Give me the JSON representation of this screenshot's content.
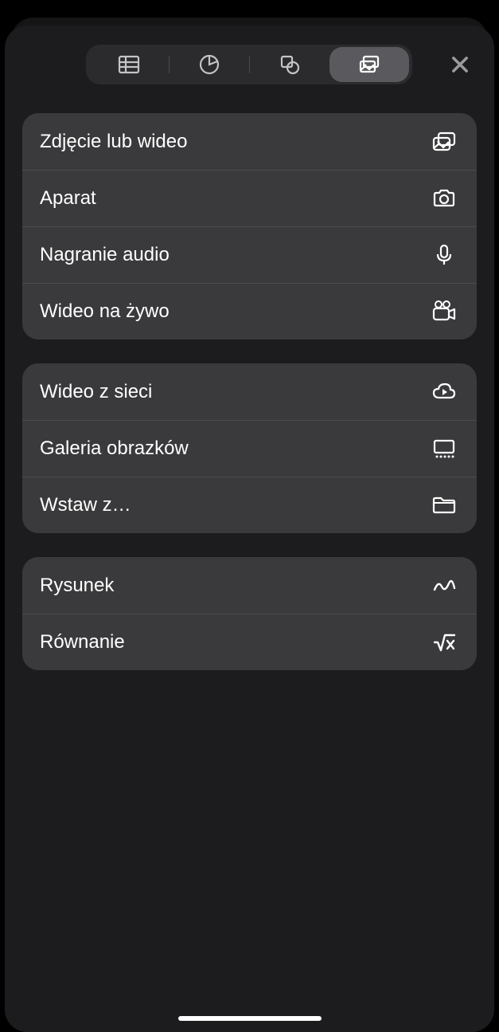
{
  "segments": {
    "tables": "tables",
    "charts": "charts",
    "shapes": "shapes",
    "media": "media"
  },
  "groups": [
    {
      "items": [
        {
          "label": "Zdjęcie lub wideo",
          "icon": "photo-video-icon"
        },
        {
          "label": "Aparat",
          "icon": "camera-icon"
        },
        {
          "label": "Nagranie audio",
          "icon": "microphone-icon"
        },
        {
          "label": "Wideo na żywo",
          "icon": "video-camera-icon"
        }
      ]
    },
    {
      "items": [
        {
          "label": "Wideo z sieci",
          "icon": "cloud-play-icon"
        },
        {
          "label": "Galeria obrazków",
          "icon": "gallery-icon"
        },
        {
          "label": "Wstaw z…",
          "icon": "folder-icon"
        }
      ]
    },
    {
      "items": [
        {
          "label": "Rysunek",
          "icon": "scribble-icon"
        },
        {
          "label": "Równanie",
          "icon": "equation-icon"
        }
      ]
    }
  ]
}
